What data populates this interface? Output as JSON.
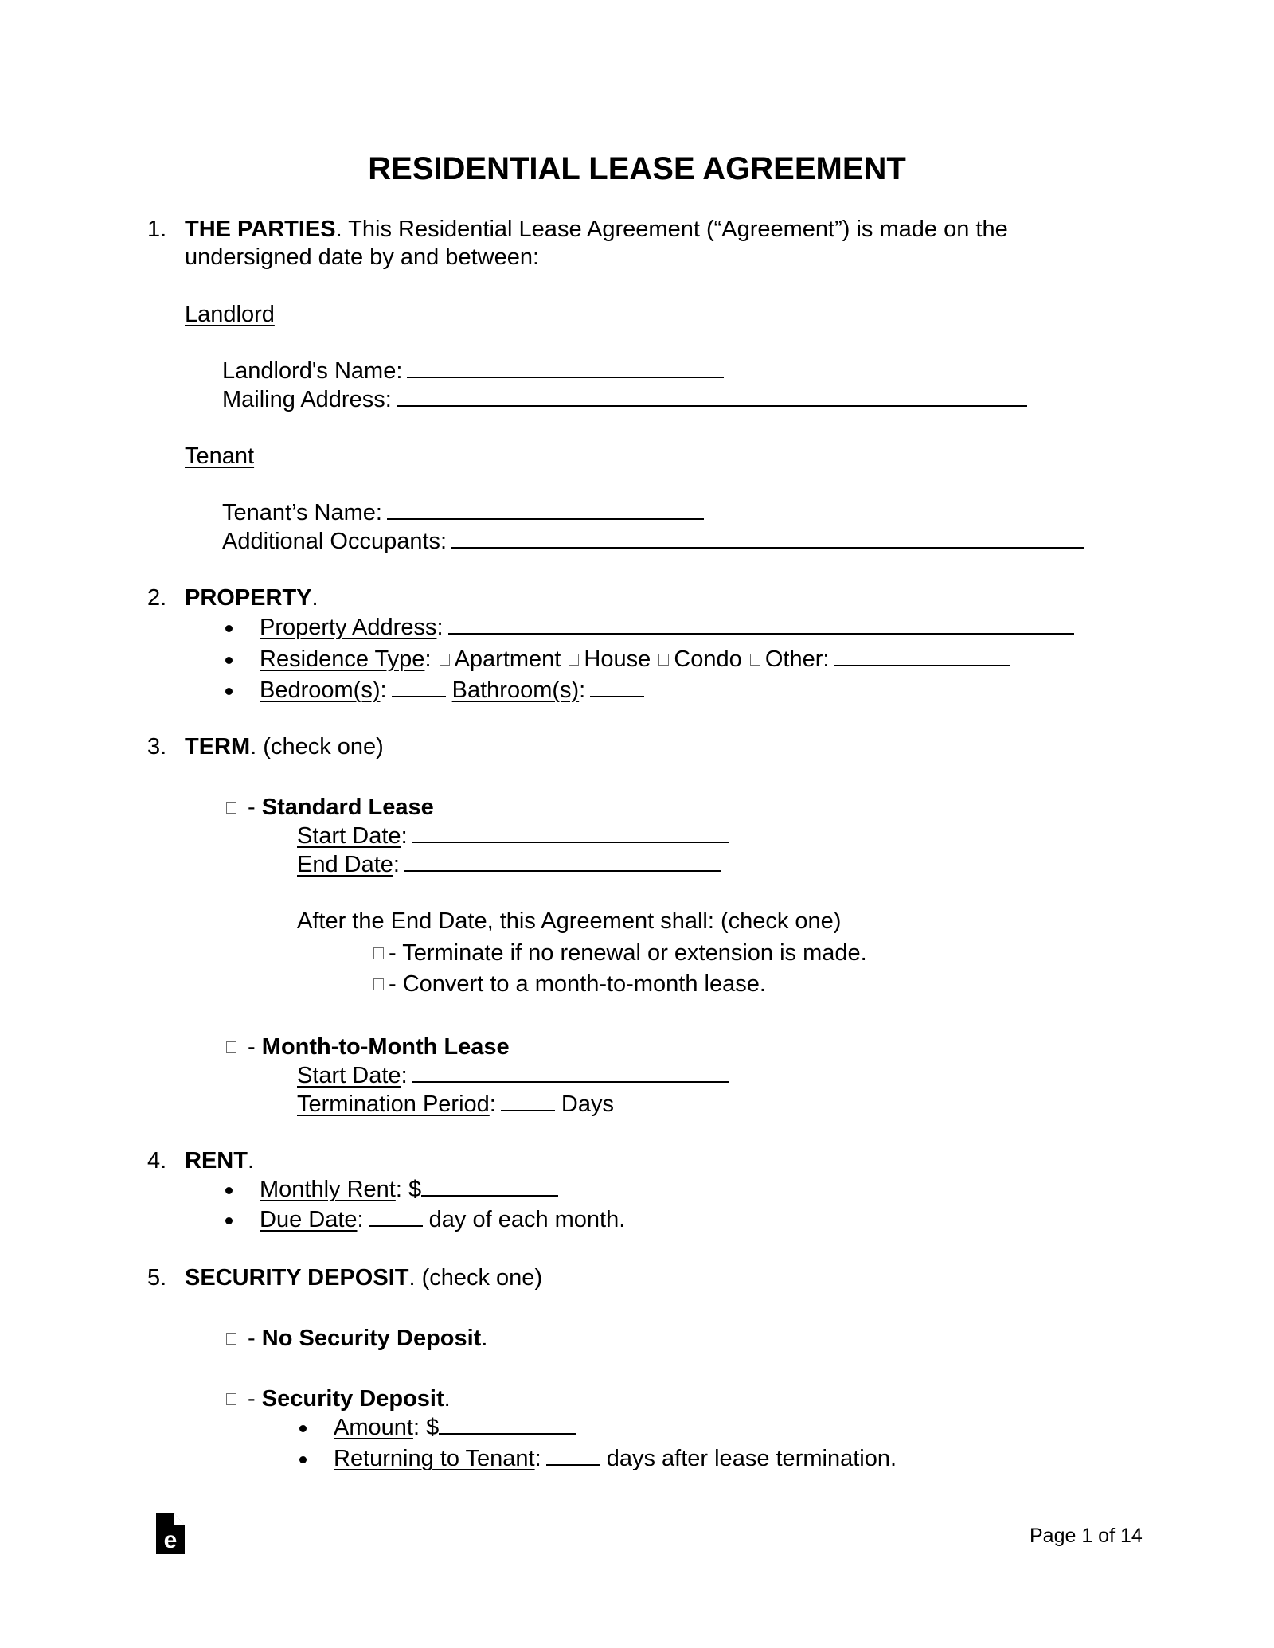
{
  "title": "RESIDENTIAL LEASE AGREEMENT",
  "sections": {
    "parties": {
      "num": "1.",
      "heading": "THE PARTIES",
      "text1": ". This Residential Lease Agreement (“Agreement”) is made on the",
      "text2": "undersigned date by and between:",
      "landlord": {
        "label": "Landlord",
        "name_label": "Landlord's Name:",
        "name_value": "",
        "address_label": "Mailing Address:",
        "address_value": ""
      },
      "tenant": {
        "label": "Tenant",
        "name_label": "Tenant’s Name:",
        "name_value": "",
        "occupants_label": "Additional Occupants:",
        "occupants_value": ""
      }
    },
    "property": {
      "num": "2.",
      "heading": "PROPERTY",
      "period": ".",
      "address_label": "Property Address",
      "address_value": "",
      "residence_label": "Residence Type",
      "residence_options": [
        "Apartment",
        "House",
        "Condo",
        "Other:"
      ],
      "other_value": "",
      "bedrooms_label": "Bedroom(s)",
      "bedrooms_value": "",
      "bathrooms_label": "Bathroom(s)",
      "bathrooms_value": ""
    },
    "term": {
      "num": "3.",
      "heading": "TERM",
      "note": ". (check one)",
      "standard": {
        "label": "Standard Lease",
        "start_label": "Start Date",
        "start_value": "",
        "end_label": "End Date",
        "end_value": "",
        "after_text": "After the End Date, this Agreement shall: (check one)",
        "option_terminate": "- Terminate if no renewal or extension is made.",
        "option_convert": "- Convert to a month-to-month lease."
      },
      "monthly": {
        "label": "Month-to-Month Lease",
        "start_label": "Start Date",
        "start_value": "",
        "period_label": "Termination Period",
        "period_value": "",
        "period_unit": "Days"
      }
    },
    "rent": {
      "num": "4.",
      "heading": "RENT",
      "period": ".",
      "monthly_label": "Monthly Rent",
      "monthly_prefix": ": $",
      "monthly_value": "",
      "due_label": "Due Date",
      "due_value": "",
      "due_suffix": "day of each month."
    },
    "deposit": {
      "num": "5.",
      "heading": "SECURITY DEPOSIT",
      "note": ". (check one)",
      "none_label": "No Security Deposit",
      "with_label": "Security Deposit",
      "amount_label": "Amount",
      "amount_prefix": ": $",
      "amount_value": "",
      "return_label": "Returning to Tenant",
      "return_value": "",
      "return_suffix": "days after lease termination."
    }
  },
  "footer": {
    "logo_icon": "eforms-logo-icon",
    "page_text": "Page 1 of 14"
  }
}
